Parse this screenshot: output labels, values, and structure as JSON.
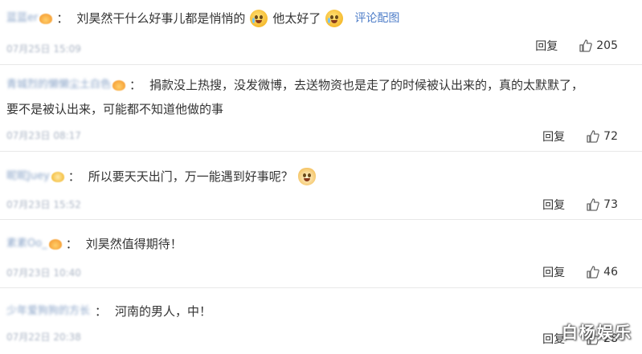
{
  "comments": [
    {
      "username": "蓝蓝er",
      "text_before": "刘昊然干什么好事儿都是悄悄的",
      "text_middle": "他太好了",
      "link": "评论配图",
      "time": "07月25日 15:09",
      "reply_label": "回复",
      "likes": "205"
    },
    {
      "username": "青城烈的懒懒尘土白色",
      "text_line1": "捐款没上热搜，没发微博，去送物资也是走了的时候被认出来的，真的太默默了，",
      "text_line2": "要不是被认出来，可能都不知道他做的事",
      "time": "07月23日 08:17",
      "reply_label": "回复",
      "likes": "72"
    },
    {
      "username": "昵昵Juey",
      "text": "所以要天天出门，万一能遇到好事呢？",
      "time": "07月23日 15:52",
      "reply_label": "回复",
      "likes": "73"
    },
    {
      "username": "素素Oo_",
      "text": "刘昊然值得期待！",
      "time": "07月23日 10:40",
      "reply_label": "回复",
      "likes": "46"
    },
    {
      "username": "少年爱狗狗的方长",
      "text": "河南的男人，中！",
      "time": "07月22日 20:38",
      "reply_label": "回复",
      "likes": "28"
    }
  ],
  "watermark": "白杨娱乐",
  "colon": "："
}
